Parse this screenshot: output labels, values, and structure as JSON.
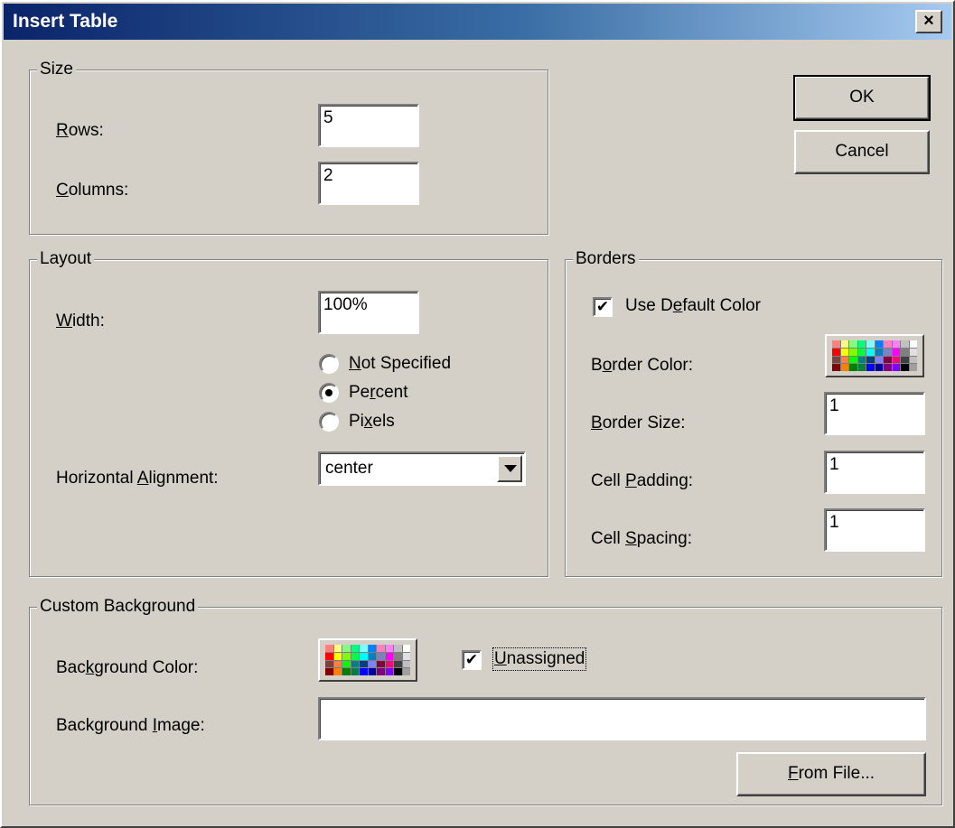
{
  "window": {
    "title": "Insert Table",
    "close_symbol": "×"
  },
  "size": {
    "group_label": "Size",
    "rows_label_prefix": "",
    "rows_label_key": "R",
    "rows_label_rest": "ows:",
    "rows_value": "5",
    "columns_label_prefix": "",
    "columns_label_key": "C",
    "columns_label_rest": "olumns:",
    "columns_value": "2"
  },
  "buttons": {
    "ok": "OK",
    "cancel": "Cancel",
    "from_file_key": "F",
    "from_file_rest": "rom File..."
  },
  "layout": {
    "group_label": "Layout",
    "width_label_key": "W",
    "width_label_rest": "idth:",
    "width_value": "100%",
    "radio_not_specified_key": "N",
    "radio_not_specified_rest": "ot Specified",
    "radio_percent_pre": "Pe",
    "radio_percent_key": "r",
    "radio_percent_rest": "cent",
    "radio_pixels_pre": "Pi",
    "radio_pixels_key": "x",
    "radio_pixels_rest": "els",
    "selected_radio": "percent",
    "halign_label_pre": "Horizontal ",
    "halign_label_key": "A",
    "halign_label_rest": "lignment:",
    "halign_value": "center"
  },
  "borders": {
    "group_label": "Borders",
    "use_default_pre": "Use D",
    "use_default_key": "e",
    "use_default_rest": "fault Color",
    "use_default_checked": true,
    "border_color_pre": "B",
    "border_color_key": "o",
    "border_color_rest": "rder Color:",
    "border_size_key": "B",
    "border_size_rest": "order Size:",
    "border_size_value": "1",
    "cell_padding_pre": "Cell ",
    "cell_padding_key": "P",
    "cell_padding_rest": "adding:",
    "cell_padding_value": "1",
    "cell_spacing_pre": "Cell ",
    "cell_spacing_key": "S",
    "cell_spacing_rest": "pacing:",
    "cell_spacing_value": "1"
  },
  "background": {
    "group_label": "Custom Background",
    "bg_color_pre": "Bac",
    "bg_color_key": "k",
    "bg_color_rest": "ground Color:",
    "unassigned_key": "U",
    "unassigned_rest": "nassigned",
    "unassigned_checked": true,
    "bg_image_pre": "Background ",
    "bg_image_key": "I",
    "bg_image_rest": "mage:",
    "bg_image_value": ""
  },
  "palette_colors": [
    "#ff8080",
    "#ffff80",
    "#80ff80",
    "#00ff80",
    "#80ffff",
    "#0080ff",
    "#ff80c0",
    "#ff80ff",
    "#c0c0c0",
    "#ffffff",
    "#ff0000",
    "#ffff00",
    "#80ff00",
    "#00ff40",
    "#00ffff",
    "#0080c0",
    "#8080c0",
    "#ff00ff",
    "#808080",
    "#e0e0e0",
    "#804040",
    "#ff8040",
    "#00ff00",
    "#008080",
    "#004080",
    "#8080ff",
    "#800040",
    "#ff0080",
    "#404040",
    "#c0c0c0",
    "#800000",
    "#ff8000",
    "#008000",
    "#008040",
    "#0000ff",
    "#0000a0",
    "#800080",
    "#8000ff",
    "#000000",
    "#a0a0a0"
  ],
  "checkmark": "✔"
}
